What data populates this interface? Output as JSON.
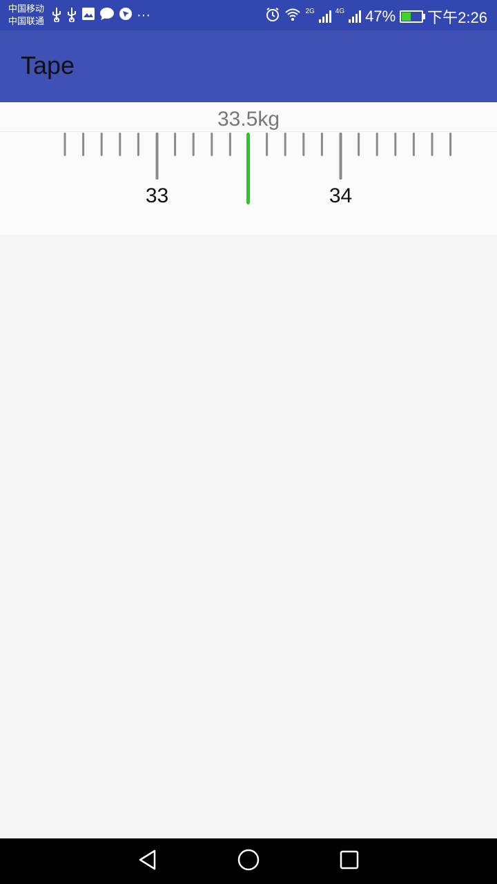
{
  "status_bar": {
    "carrier_1": "中国移动",
    "carrier_2": "中国联通",
    "left_icons": [
      "usb-icon",
      "usb-icon",
      "gallery-icon",
      "message-icon",
      "location-icon"
    ],
    "more": "···",
    "net_2g": "2G",
    "net_4g": "4G",
    "battery_percent": "47%",
    "time": "下午2:26",
    "battery_level": 0.47
  },
  "app_bar": {
    "title": "Tape",
    "color": "#3f51b5"
  },
  "tape": {
    "current_value_label": "33.5kg",
    "current_value": 33.5,
    "unit": "kg",
    "step": 0.1,
    "visible_min": 32.5,
    "visible_max": 34.5,
    "major_labels": [
      "33",
      "34"
    ],
    "indicator_color": "#22cc22",
    "tick_color": "#8a8a8a"
  },
  "nav_bar": {
    "buttons": [
      "back-icon",
      "home-icon",
      "recents-icon"
    ]
  }
}
